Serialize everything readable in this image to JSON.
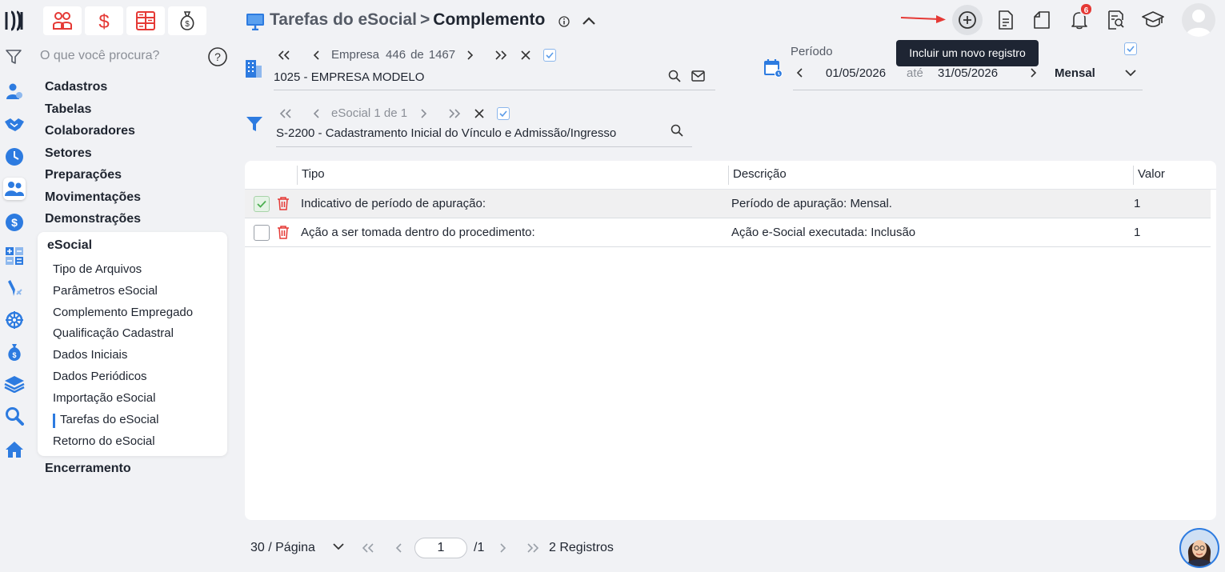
{
  "search": {
    "placeholder": "O que você procura?"
  },
  "menu": {
    "top_items": [
      "Cadastros",
      "Tabelas",
      "Colaboradores",
      "Setores",
      "Preparações",
      "Movimentações",
      "Demonstrações"
    ],
    "section": "eSocial",
    "sub_items": [
      "Tipo de Arquivos",
      "Parâmetros eSocial",
      "Complemento Empregado",
      "Qualificação Cadastral",
      "Dados Iniciais",
      "Dados Periódicos",
      "Importação eSocial",
      "Tarefas do eSocial",
      "Retorno do eSocial"
    ],
    "active_sub": "Tarefas do eSocial",
    "after": "Encerramento"
  },
  "header": {
    "crumb": "Tarefas do eSocial",
    "separator": ">",
    "current": "Complemento",
    "tooltip": "Incluir um novo registro",
    "notif_count": "6"
  },
  "empresa": {
    "label": "Empresa",
    "index": "446",
    "of": "de",
    "total": "1467",
    "value": "1025 - EMPRESA MODELO"
  },
  "periodo": {
    "label": "Período",
    "start": "01/05/2026",
    "until": "até",
    "end": "31/05/2026",
    "type": "Mensal"
  },
  "esocial": {
    "label": "eSocial 1 de 1",
    "value": "S-2200 - Cadastramento Inicial do Vínculo e Admissão/Ingresso"
  },
  "table": {
    "columns": [
      "Tipo",
      "Descrição",
      "Valor"
    ],
    "rows": [
      {
        "tipo": "Indicativo de período de apuração:",
        "descricao": "Período de apuração: Mensal.",
        "valor": "1",
        "checked": true
      },
      {
        "tipo": "Ação a ser tomada dentro do procedimento:",
        "descricao": "Ação e-Social executada: Inclusão",
        "valor": "1",
        "checked": false
      }
    ]
  },
  "pagination": {
    "per_page": "30 / Página",
    "page": "1",
    "of_pages": "/1",
    "records": "2 Registros"
  },
  "colors": {
    "accent": "#2d7be0",
    "danger": "#e53935",
    "brand_dark": "#1e2533"
  }
}
